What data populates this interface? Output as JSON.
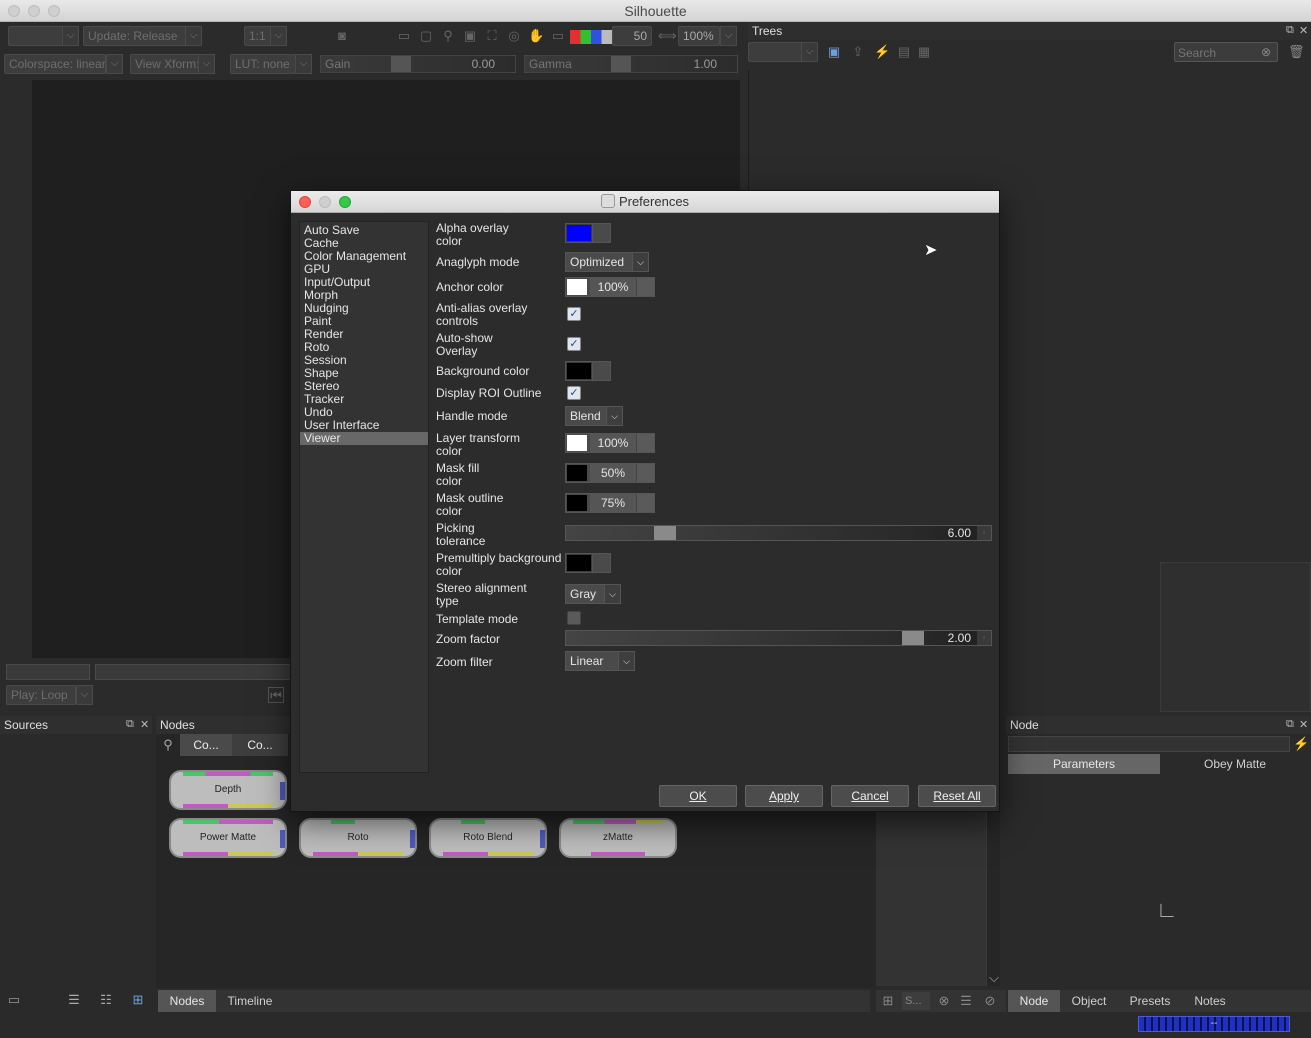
{
  "window": {
    "title": "Silhouette"
  },
  "toolbar": {
    "update_mode": "Update: Release",
    "ratio": "1:1",
    "frame_value": "50",
    "zoom": "100%",
    "colorspace": "Colorspace: linear",
    "view_xform": "View Xform:",
    "lut": "LUT: none",
    "gain_label": "Gain",
    "gain_value": "0.00",
    "gamma_label": "Gamma",
    "gamma_value": "1.00"
  },
  "playback": {
    "mode": "Play: Loop"
  },
  "trees": {
    "title": "Trees",
    "search_placeholder": "Search"
  },
  "sources": {
    "title": "Sources"
  },
  "nodes_panel": {
    "title": "Nodes",
    "col1": "Co...",
    "col2": "Co...",
    "nodes": [
      {
        "label": "Depth"
      },
      {
        "label": "Power Matte"
      },
      {
        "label": "Roto"
      },
      {
        "label": "Roto Blend"
      },
      {
        "label": "zMatte"
      }
    ]
  },
  "bottom_tabs": {
    "nodes": "Nodes",
    "timeline": "Timeline"
  },
  "node_panel": {
    "title": "Node",
    "tab_parameters": "Parameters",
    "tab_obey_matte": "Obey Matte"
  },
  "right_bottom_tabs": {
    "node": "Node",
    "object": "Object",
    "presets": "Presets",
    "notes": "Notes"
  },
  "object_panel": {
    "field": "S..."
  },
  "status": {
    "progress_label": "--"
  },
  "preferences": {
    "title": "Preferences",
    "categories": [
      "Auto Save",
      "Cache",
      "Color Management",
      "GPU",
      "Input/Output",
      "Morph",
      "Nudging",
      "Paint",
      "Render",
      "Roto",
      "Session",
      "Shape",
      "Stereo",
      "Tracker",
      "Undo",
      "User Interface",
      "Viewer"
    ],
    "selected_category": "Viewer",
    "labels": {
      "alpha_overlay": "Alpha overlay\ncolor",
      "anaglyph_mode": "Anaglyph mode",
      "anchor_color": "Anchor color",
      "anti_alias": "Anti-alias overlay\ncontrols",
      "auto_show": "Auto-show\nOverlay",
      "background_color": "Background color",
      "display_roi": "Display ROI Outline",
      "handle_mode": "Handle mode",
      "layer_transform": "Layer transform\ncolor",
      "mask_fill": "Mask fill\ncolor",
      "mask_outline": "Mask outline\ncolor",
      "picking_tolerance": "Picking\ntolerance",
      "premultiply_bg": "Premultiply background\ncolor",
      "stereo_alignment": "Stereo alignment\ntype",
      "template_mode": "Template mode",
      "zoom_factor": "Zoom factor",
      "zoom_filter": "Zoom filter"
    },
    "values": {
      "anaglyph_mode": "Optimized",
      "anchor_pct": "100%",
      "handle_mode": "Blend",
      "layer_transform_pct": "100%",
      "mask_fill_pct": "50%",
      "mask_outline_pct": "75%",
      "picking_tolerance": "6.00",
      "stereo_alignment": "Gray",
      "zoom_factor": "2.00",
      "zoom_filter": "Linear"
    },
    "checks": {
      "anti_alias": true,
      "auto_show": true,
      "display_roi": true,
      "template_mode": false
    },
    "buttons": {
      "ok": "OK",
      "apply": "Apply",
      "cancel": "Cancel",
      "reset_all": "Reset All"
    },
    "colors": {
      "alpha_overlay": "#0000ff",
      "anchor": "#ffffff",
      "background": "#000000",
      "layer_transform": "#ffffff",
      "mask_fill": "#000000",
      "mask_outline": "#000000",
      "premultiply": "#000000"
    }
  }
}
